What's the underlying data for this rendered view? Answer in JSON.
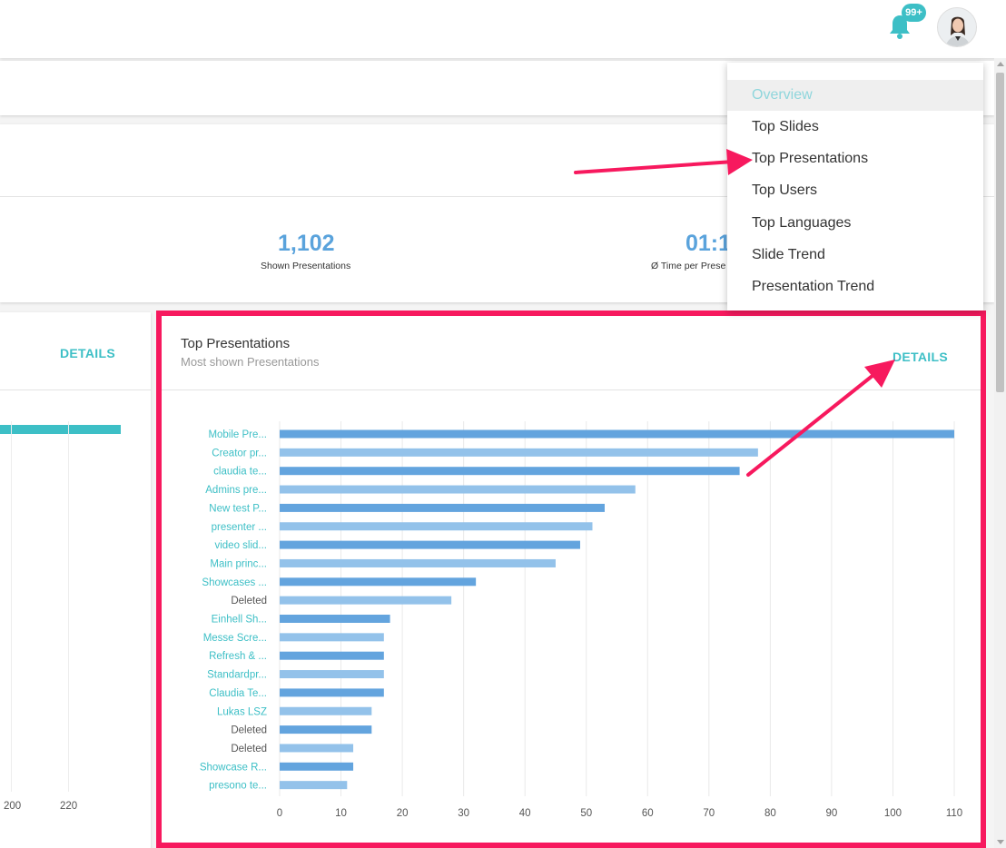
{
  "header": {
    "notification_count": "99+"
  },
  "stats": {
    "shown_presentations_value": "1,102",
    "shown_presentations_label": "Shown Presentations",
    "time_value": "01:1",
    "time_label": "Ø Time per Prese"
  },
  "left_card": {
    "details_label": "DETAILS",
    "x_ticks": [
      "200",
      "220"
    ]
  },
  "main_card": {
    "title": "Top Presentations",
    "subtitle": "Most shown Presentations",
    "details_label": "DETAILS"
  },
  "menu": {
    "items": [
      "Overview",
      "Top Slides",
      "Top Presentations",
      "Top Users",
      "Top Languages",
      "Slide Trend",
      "Presentation Trend"
    ],
    "active": "Overview"
  },
  "colors": {
    "accent": "#3dbfc6",
    "bar_dark": "#63a4de",
    "bar_light": "#93c2ea",
    "highlight": "#f7195e",
    "stat_value": "#5aa3dc"
  },
  "chart_data": {
    "type": "bar",
    "orientation": "horizontal",
    "title": "Top Presentations",
    "subtitle": "Most shown Presentations",
    "categories": [
      "Mobile Pre...",
      "Creator pr...",
      "claudia te...",
      "Admins pre...",
      "New test P...",
      "presenter ...",
      "video slid...",
      "Main princ...",
      "Showcases ...",
      "Deleted",
      "Einhell Sh...",
      "Messe Scre...",
      "Refresh & ...",
      "Standardpr...",
      "Claudia Te...",
      "Lukas LSZ",
      "Deleted",
      "Deleted",
      "Showcase R...",
      "presono te..."
    ],
    "values": [
      110,
      78,
      75,
      58,
      53,
      51,
      49,
      45,
      32,
      28,
      18,
      17,
      17,
      17,
      17,
      15,
      15,
      12,
      12,
      11
    ],
    "xlim": [
      0,
      110
    ],
    "x_ticks": [
      0,
      10,
      20,
      30,
      40,
      50,
      60,
      70,
      80,
      90,
      100,
      110
    ],
    "grid": true
  }
}
